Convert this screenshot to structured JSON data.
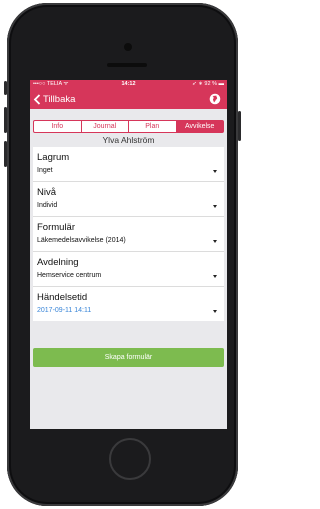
{
  "status_bar": {
    "carrier": "•••○○ TELIA ᯤ",
    "time": "14:12",
    "right": "➶ ∗ 92 % ▬"
  },
  "nav": {
    "back_label": "Tillbaka",
    "right_icon": "globe-icon"
  },
  "tabs": [
    {
      "label": "Info",
      "active": false
    },
    {
      "label": "Journal",
      "active": false
    },
    {
      "label": "Plan",
      "active": false
    },
    {
      "label": "Avvikelse",
      "active": true
    }
  ],
  "user_name": "Ylva Ahlström",
  "fields": [
    {
      "label": "Lagrum",
      "value": "Inget"
    },
    {
      "label": "Nivå",
      "value": "Individ"
    },
    {
      "label": "Formulär",
      "value": "Läkemedelsavvikelse (2014)"
    },
    {
      "label": "Avdelning",
      "value": "Hemservice centrum"
    },
    {
      "label": "Händelsetid",
      "value": "2017-09-11 14:11"
    }
  ],
  "create_button": "Skapa formulär",
  "colors": {
    "accent": "#d6365a",
    "button": "#7dbb4f",
    "date": "#3a86d8"
  }
}
